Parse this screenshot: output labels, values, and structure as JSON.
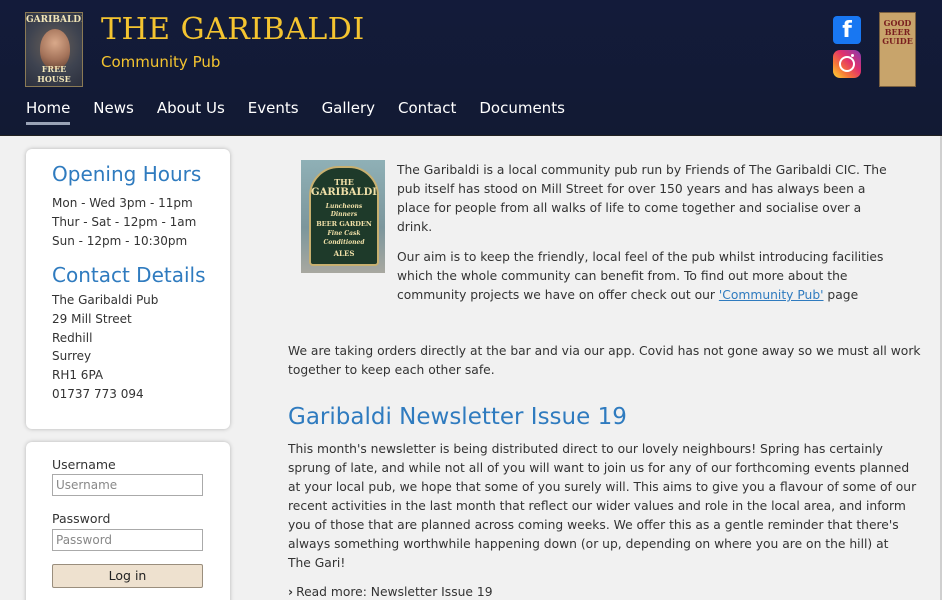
{
  "header": {
    "logo_top": "GARIBALDI",
    "logo_bottom": "FREE HOUSE",
    "title": "THE GARIBALDI",
    "subtitle": "Community Pub",
    "facebook_glyph": "f",
    "good_beer_guide_text": "GOOD BEER GUIDE",
    "icons": {
      "facebook": "facebook-icon",
      "instagram": "instagram-icon",
      "good_beer_guide": "good-beer-guide-logo"
    }
  },
  "nav": {
    "items": [
      {
        "label": "Home"
      },
      {
        "label": "News"
      },
      {
        "label": "About Us"
      },
      {
        "label": "Events"
      },
      {
        "label": "Gallery"
      },
      {
        "label": "Contact"
      },
      {
        "label": "Documents"
      }
    ],
    "active": "Home"
  },
  "sidebar": {
    "opening_hours_title": "Opening Hours",
    "hours": [
      "Mon - Wed 3pm - 11pm",
      "Thur - Sat - 12pm - 1am",
      "Sun - 12pm - 10:30pm"
    ],
    "contact_title": "Contact Details",
    "contact_lines": [
      "The Garibaldi Pub",
      "29 Mill Street",
      "Redhill",
      "Surrey",
      "RH1 6PA",
      "01737 773 094"
    ]
  },
  "login": {
    "username_label": "Username",
    "username_placeholder": "Username",
    "password_label": "Password",
    "password_placeholder": "Password",
    "button_label": "Log in"
  },
  "main": {
    "sign_text": [
      "THE",
      "GARIBALDI",
      "Luncheons",
      "Dinners",
      "BEER GARDEN",
      "Fine Cask",
      "Conditioned",
      "ALES"
    ],
    "intro_lines": [
      "The Garibaldi is a local community pub run by Friends of The Garibaldi CIC. The",
      "pub itself has stood on Mill Street for over 150 years and has always been a",
      "place for people from all walks of life to come together and socialise over a",
      "drink."
    ],
    "aim_lines": [
      "Our aim is to keep the friendly, local feel of the pub whilst introducing facilities",
      "which the whole community can benefit from. To find out more about the",
      "community projects we have on offer check out our"
    ],
    "community_link": "'Community Pub'",
    "aim_suffix": " page",
    "orders_lines": [
      "We are taking orders directly at the bar and via our app. Covid has not gone away so we must all work",
      "together to keep each other safe."
    ],
    "article_title": "Garibaldi Newsletter Issue 19",
    "article_lines": [
      "This month's newsletter is being distributed direct to our lovely neighbours! Spring has certainly",
      "sprung of late, and while not all of you will want to join us for any of our forthcoming events planned",
      "at your local pub, we hope that some of you surely will. This aims to give you a flavour of some of our",
      "recent activities in the last month that reflect our wider values and role in the local area, and inform",
      "you of those that are planned across coming weeks. We offer this as a gentle reminder that there's",
      "always something worthwhile happening down (or up, depending on where you are on the hill) at",
      "The Gari!"
    ],
    "read_more": "Read more: Newsletter Issue 19"
  }
}
